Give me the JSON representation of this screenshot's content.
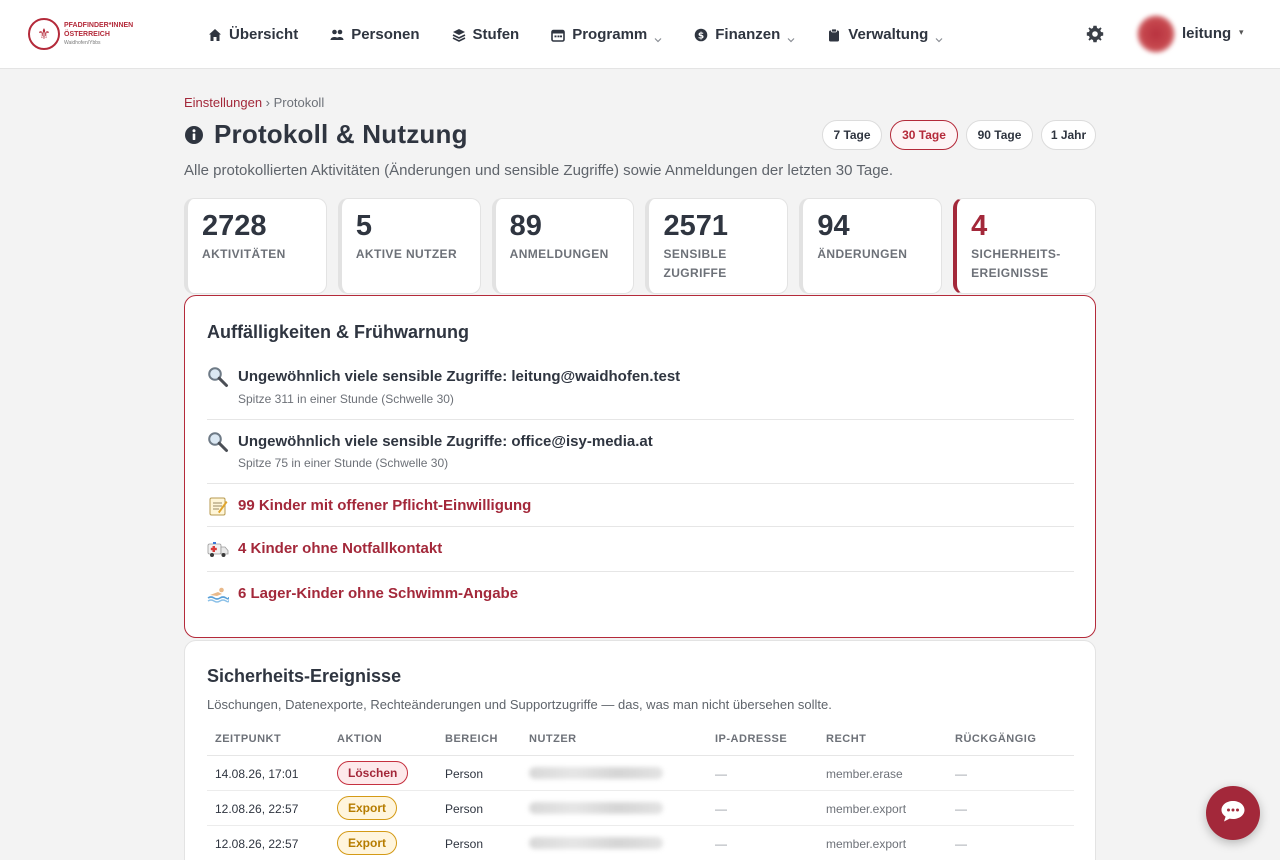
{
  "logo": {
    "line1": "PFADFINDER*INNEN",
    "line2": "ÖSTERREICH",
    "line3": "Waidhofen/Ybbs"
  },
  "nav": {
    "items": [
      {
        "label": "Übersicht",
        "icon": "home-icon",
        "dropdown": false
      },
      {
        "label": "Personen",
        "icon": "users-icon",
        "dropdown": false
      },
      {
        "label": "Stufen",
        "icon": "layers-icon",
        "dropdown": false
      },
      {
        "label": "Programm",
        "icon": "calendar-icon",
        "dropdown": true
      },
      {
        "label": "Finanzen",
        "icon": "dollar-icon",
        "dropdown": true
      },
      {
        "label": "Verwaltung",
        "icon": "clipboard-icon",
        "dropdown": true
      }
    ],
    "user_name": "leitung",
    "user_caret": "▾"
  },
  "breadcrumb": {
    "parent": "Einstellungen",
    "separator": " › ",
    "current": "Protokoll"
  },
  "page": {
    "title": "Protokoll & Nutzung",
    "subtitle": "Alle protokollierten Aktivitäten (Änderungen und sensible Zugriffe) sowie Anmeldungen der letzten 30 Tage."
  },
  "ranges": [
    {
      "label": "7 Tage",
      "active": false
    },
    {
      "label": "30 Tage",
      "active": true
    },
    {
      "label": "90 Tage",
      "active": false
    },
    {
      "label": "1 Jahr",
      "active": false
    }
  ],
  "stats": [
    {
      "value": "2728",
      "label": "AKTIVITÄTEN"
    },
    {
      "value": "5",
      "label": "AKTIVE NUTZER"
    },
    {
      "value": "89",
      "label": "ANMELDUNGEN"
    },
    {
      "value": "2571",
      "label": "SENSIBLE ZUGRIFFE"
    },
    {
      "value": "94",
      "label": "ÄNDERUNGEN"
    },
    {
      "value": "4",
      "label": "SICHERHEITS-EREIGNISSE"
    }
  ],
  "warnings": {
    "title": "Auffälligkeiten & Frühwarnung",
    "items": [
      {
        "icon": "magnifier-icon",
        "title": "Ungewöhnlich viele sensible Zugriffe: leitung@waidhofen.test",
        "sub": "Spitze 311 in einer Stunde (Schwelle 30)",
        "style": "dark"
      },
      {
        "icon": "magnifier-icon",
        "title": "Ungewöhnlich viele sensible Zugriffe: office@isy-media.at",
        "sub": "Spitze 75 in einer Stunde (Schwelle 30)",
        "style": "dark"
      },
      {
        "icon": "memo-icon",
        "title": "99 Kinder mit offener Pflicht-Einwilligung",
        "sub": "",
        "style": "red"
      },
      {
        "icon": "ambulance-icon",
        "title": "4 Kinder ohne Notfallkontakt",
        "sub": "",
        "style": "red"
      },
      {
        "icon": "swimmer-icon",
        "title": "6 Lager-Kinder ohne Schwimm-Angabe",
        "sub": "",
        "style": "red"
      }
    ]
  },
  "security": {
    "title": "Sicherheits-Ereignisse",
    "description": "Löschungen, Datenexporte, Rechteänderungen und Supportzugriffe — das, was man nicht übersehen sollte.",
    "columns": [
      "ZEITPUNKT",
      "AKTION",
      "BEREICH",
      "NUTZER",
      "IP-ADRESSE",
      "RECHT",
      "RÜCKGÄNGIG"
    ],
    "rows": [
      {
        "time": "14.08.26, 17:01",
        "action": "Löschen",
        "action_type": "delete",
        "area": "Person",
        "ip": "—",
        "right": "member.erase",
        "undo": "—"
      },
      {
        "time": "12.08.26, 22:57",
        "action": "Export",
        "action_type": "export",
        "area": "Person",
        "ip": "—",
        "right": "member.export",
        "undo": "—"
      },
      {
        "time": "12.08.26, 22:57",
        "action": "Export",
        "action_type": "export",
        "area": "Person",
        "ip": "—",
        "right": "member.export",
        "undo": "—"
      }
    ]
  },
  "colors": {
    "brand": "#a3283a",
    "warning_badge": "#b67c00",
    "text": "#2f3540"
  }
}
